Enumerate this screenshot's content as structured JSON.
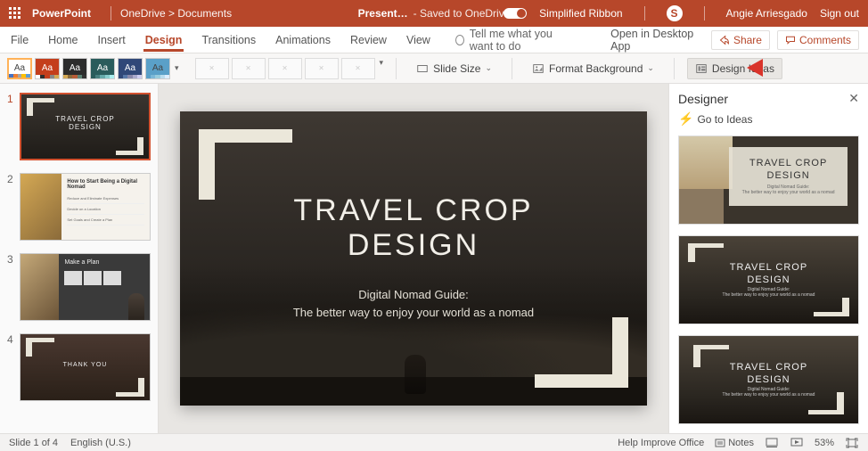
{
  "titlebar": {
    "app": "PowerPoint",
    "path": "OneDrive > Documents",
    "filename": "Present…",
    "savestatus": "- Saved to OneDrive",
    "simplified": "Simplified Ribbon",
    "user": "Angie Arriesgado",
    "signout": "Sign out"
  },
  "menu": {
    "tabs": [
      "File",
      "Home",
      "Insert",
      "Design",
      "Transitions",
      "Animations",
      "Review",
      "View"
    ],
    "active": "Design",
    "tell": "Tell me what you want to do",
    "openapp": "Open in Desktop App",
    "share": "Share",
    "comments": "Comments"
  },
  "ribbon": {
    "slidesize": "Slide Size",
    "formatbg": "Format Background",
    "designideas": "Design Ideas"
  },
  "slide": {
    "title_l1": "TRAVEL CROP",
    "title_l2": "DESIGN",
    "sub1": "Digital Nomad Guide:",
    "sub2": "The better way to enjoy your world as a nomad"
  },
  "thumbs": {
    "t1_title": "TRAVEL CROP\nDESIGN",
    "t2_title": "How to Start Being a Digital Nomad",
    "t2_items": [
      "Reduce and Eliminate Expenses",
      "Decide on a Location",
      "Set Goals and Create a Plan"
    ],
    "t3_title": "Make a Plan",
    "t4_title": "THANK YOU"
  },
  "designer": {
    "title": "Designer",
    "goto": "Go to Ideas",
    "item_title": "TRAVEL CROP\nDESIGN",
    "item_sub1": "Digital Nomad Guide:",
    "item_sub2": "The better way to enjoy your world as a nomad"
  },
  "status": {
    "slide": "Slide 1 of 4",
    "lang": "English (U.S.)",
    "help": "Help Improve Office",
    "notes": "Notes",
    "zoom": "53%"
  }
}
